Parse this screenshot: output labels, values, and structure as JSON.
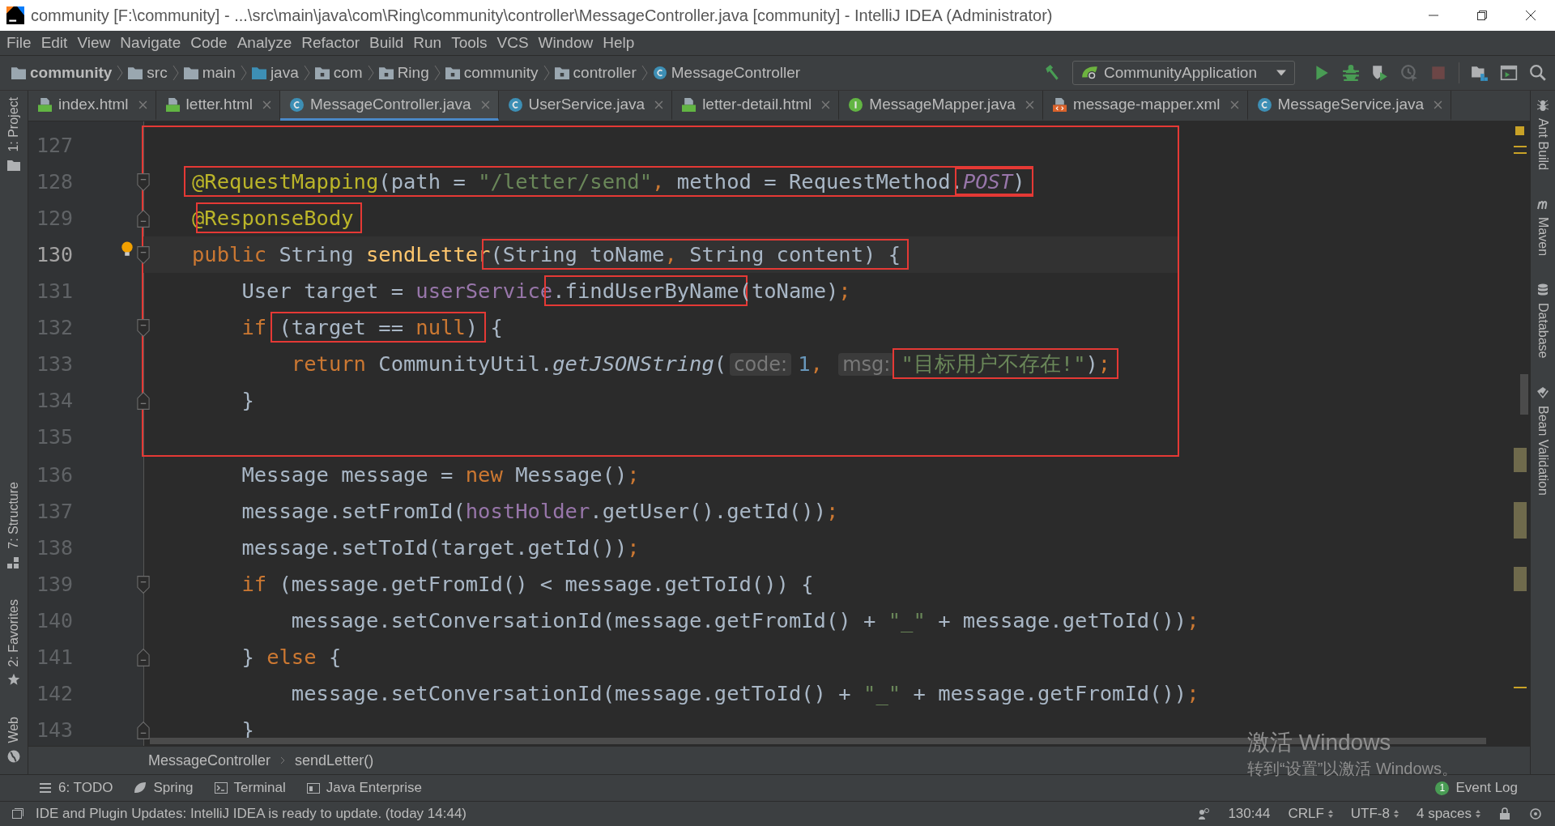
{
  "window": {
    "title": "community [F:\\community] - ...\\src\\main\\java\\com\\Ring\\community\\controller\\MessageController.java [community] - IntelliJ IDEA (Administrator)"
  },
  "menu": [
    "File",
    "Edit",
    "View",
    "Navigate",
    "Code",
    "Analyze",
    "Refactor",
    "Build",
    "Run",
    "Tools",
    "VCS",
    "Window",
    "Help"
  ],
  "navigation": [
    {
      "kind": "module",
      "label": "community"
    },
    {
      "kind": "folder",
      "label": "src"
    },
    {
      "kind": "folder",
      "label": "main"
    },
    {
      "kind": "source",
      "label": "java"
    },
    {
      "kind": "package",
      "label": "com"
    },
    {
      "kind": "package",
      "label": "Ring"
    },
    {
      "kind": "package",
      "label": "community"
    },
    {
      "kind": "package",
      "label": "controller"
    },
    {
      "kind": "class",
      "label": "MessageController"
    }
  ],
  "run_configuration": "CommunityApplication",
  "toolbar": [
    {
      "kind": "run",
      "disabled": false
    },
    {
      "kind": "debug",
      "disabled": false
    },
    {
      "kind": "coverage",
      "disabled": false
    },
    {
      "kind": "profile",
      "disabled": true
    },
    {
      "kind": "stop",
      "disabled": true
    }
  ],
  "left_stripe": [
    "1: Project",
    "7: Structure",
    "2: Favorites",
    "Web"
  ],
  "right_stripe": [
    "Ant Build",
    "Maven",
    "Database",
    "Bean Validation"
  ],
  "tabs": [
    {
      "kind": "html",
      "label": "index.html",
      "selected": false
    },
    {
      "kind": "html",
      "label": "letter.html",
      "selected": false
    },
    {
      "kind": "class",
      "label": "MessageController.java",
      "selected": true
    },
    {
      "kind": "class",
      "label": "UserService.java",
      "selected": false
    },
    {
      "kind": "html",
      "label": "letter-detail.html",
      "selected": false
    },
    {
      "kind": "interface",
      "label": "MessageMapper.java",
      "selected": false
    },
    {
      "kind": "xml",
      "label": "message-mapper.xml",
      "selected": false
    },
    {
      "kind": "class",
      "label": "MessageService.java",
      "selected": false
    }
  ],
  "code": [
    {
      "boxed": true,
      "lines": [
        {
          "number": "127",
          "current": false
        },
        {
          "number": "128",
          "fold_start": true,
          "current": false,
          "tokens": [
            {
              "kind": "group",
              "boxed": true,
              "items": [
                {
                  "kind": "annotation",
                  "text": "@RequestMapping"
                },
                {
                  "kind": "plain",
                  "text": "(path = "
                },
                {
                  "kind": "string",
                  "text": "\"/letter/send\""
                },
                {
                  "kind": "keyword",
                  "text": ", "
                },
                {
                  "kind": "plain",
                  "text": "method = RequestMethod."
                },
                {
                  "kind": "group",
                  "boxed": true,
                  "items": [
                    {
                      "kind": "constant",
                      "text": "POST"
                    },
                    {
                      "kind": "plain",
                      "text": ")"
                    }
                  ]
                }
              ]
            }
          ]
        },
        {
          "number": "129",
          "fold_end": true,
          "current": false,
          "tokens": [
            {
              "kind": "annotation",
              "text": "@"
            },
            {
              "kind": "group",
              "boxed": true,
              "items": [
                {
                  "kind": "annotation",
                  "text": "ResponseBody"
                }
              ]
            }
          ]
        },
        {
          "number": "130",
          "fold_start": true,
          "bulb": true,
          "current": true,
          "tokens": [
            {
              "kind": "keyword",
              "text": "public "
            },
            {
              "kind": "plain",
              "text": "String "
            },
            {
              "kind": "method",
              "text": "sendLetter"
            },
            {
              "kind": "group",
              "boxed": true,
              "items": [
                {
                  "kind": "plain",
                  "text": "(String toName"
                },
                {
                  "kind": "keyword",
                  "text": ", "
                },
                {
                  "kind": "plain",
                  "text": "String content) {"
                }
              ]
            }
          ]
        },
        {
          "number": "131",
          "current": false,
          "tokens": [
            {
              "kind": "plain",
              "text": "    User target = "
            },
            {
              "kind": "field",
              "text": "userService"
            },
            {
              "kind": "group",
              "boxed": true,
              "items": [
                {
                  "kind": "plain",
                  "text": ".findUserByName"
                }
              ]
            },
            {
              "kind": "plain",
              "text": "(toName)"
            },
            {
              "kind": "keyword",
              "text": ";"
            }
          ]
        },
        {
          "number": "132",
          "fold_start": true,
          "current": false,
          "tokens": [
            {
              "kind": "keyword",
              "text": "    if "
            },
            {
              "kind": "group",
              "boxed": true,
              "items": [
                {
                  "kind": "plain",
                  "text": "(target == "
                },
                {
                  "kind": "keyword",
                  "text": "null"
                },
                {
                  "kind": "plain",
                  "text": ")"
                }
              ]
            },
            {
              "kind": "plain",
              "text": " {"
            }
          ]
        },
        {
          "number": "133",
          "current": false,
          "tokens": [
            {
              "kind": "keyword",
              "text": "        return "
            },
            {
              "kind": "plain",
              "text": "CommunityUtil."
            },
            {
              "kind": "static",
              "text": "getJSONString"
            },
            {
              "kind": "plain",
              "text": "("
            },
            {
              "kind": "hint",
              "text": "code:"
            },
            {
              "kind": "number",
              "text": "1"
            },
            {
              "kind": "keyword",
              "text": ", "
            },
            {
              "kind": "hint",
              "text": "msg:"
            },
            {
              "kind": "group",
              "boxed": true,
              "items": [
                {
                  "kind": "string",
                  "text": "\"目标用户不存在!\""
                },
                {
                  "kind": "plain",
                  "text": ")"
                },
                {
                  "kind": "keyword",
                  "text": ";"
                }
              ]
            }
          ]
        },
        {
          "number": "134",
          "fold_end": true,
          "current": false,
          "tokens": [
            {
              "kind": "plain",
              "text": "    }"
            }
          ]
        },
        {
          "number": "135",
          "current": false
        }
      ]
    },
    {
      "boxed": false,
      "lines": [
        {
          "number": "136",
          "current": false,
          "tokens": [
            {
              "kind": "plain",
              "text": "    Message message = "
            },
            {
              "kind": "keyword",
              "text": "new "
            },
            {
              "kind": "plain",
              "text": "Message()"
            },
            {
              "kind": "keyword",
              "text": ";"
            }
          ]
        },
        {
          "number": "137",
          "current": false,
          "tokens": [
            {
              "kind": "plain",
              "text": "    message.setFromId("
            },
            {
              "kind": "field",
              "text": "hostHolder"
            },
            {
              "kind": "plain",
              "text": ".getUser().getId())"
            },
            {
              "kind": "keyword",
              "text": ";"
            }
          ]
        },
        {
          "number": "138",
          "current": false,
          "tokens": [
            {
              "kind": "plain",
              "text": "    message.setToId(target.getId())"
            },
            {
              "kind": "keyword",
              "text": ";"
            }
          ]
        },
        {
          "number": "139",
          "fold_start": true,
          "current": false,
          "tokens": [
            {
              "kind": "keyword",
              "text": "    if "
            },
            {
              "kind": "plain",
              "text": "(message.getFromId() < message.getToId()) {"
            }
          ]
        },
        {
          "number": "140",
          "current": false,
          "tokens": [
            {
              "kind": "plain",
              "text": "        message.setConversationId(message.getFromId() + "
            },
            {
              "kind": "string",
              "text": "\"_\""
            },
            {
              "kind": "plain",
              "text": " + message.getToId())"
            },
            {
              "kind": "keyword",
              "text": ";"
            }
          ]
        },
        {
          "number": "141",
          "fold_end": true,
          "current": false,
          "tokens": [
            {
              "kind": "plain",
              "text": "    } "
            },
            {
              "kind": "keyword",
              "text": "else "
            },
            {
              "kind": "plain",
              "text": "{"
            }
          ]
        },
        {
          "number": "142",
          "current": false,
          "tokens": [
            {
              "kind": "plain",
              "text": "        message.setConversationId(message.getToId() + "
            },
            {
              "kind": "string",
              "text": "\"_\""
            },
            {
              "kind": "plain",
              "text": " + message.getFromId())"
            },
            {
              "kind": "keyword",
              "text": ";"
            }
          ]
        },
        {
          "number": "143",
          "fold_end": true,
          "current": false,
          "tokens": [
            {
              "kind": "plain",
              "text": "    }"
            }
          ]
        }
      ]
    }
  ],
  "breadcrumbs": [
    "MessageController",
    "sendLetter()"
  ],
  "tool_windows": [
    {
      "kind": "todo",
      "label": "6: TODO"
    },
    {
      "kind": "spring",
      "label": "Spring"
    },
    {
      "kind": "terminal",
      "label": "Terminal"
    },
    {
      "kind": "enterprise",
      "label": "Java Enterprise"
    }
  ],
  "event_log": {
    "count": "1",
    "label": "Event Log"
  },
  "activation": {
    "title": "激活 Windows",
    "hint": "转到“设置”以激活 Windows。"
  },
  "status_bar": {
    "message": "IDE and Plugin Updates: IntelliJ IDEA is ready to update. (today 14:44)",
    "position": "130:44",
    "line_separator": "CRLF",
    "encoding": "UTF-8",
    "indent": "4 spaces"
  }
}
